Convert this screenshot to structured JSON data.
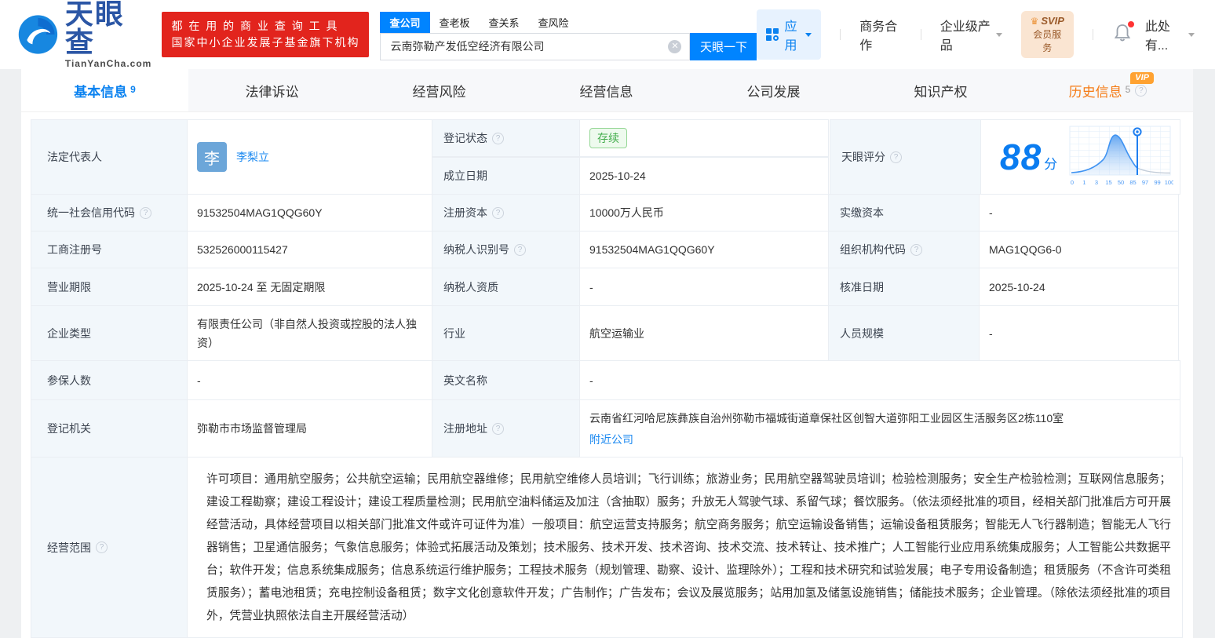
{
  "header": {
    "logo": {
      "title": "天眼查",
      "subtitle": "TianYanCha.com"
    },
    "slogan_line1": "都 在 用 的 商 业 查 询 工 具",
    "slogan_line2": "国家中小企业发展子基金旗下机构",
    "search": {
      "tabs": [
        {
          "label": "查公司",
          "active": true
        },
        {
          "label": "查老板",
          "active": false
        },
        {
          "label": "查关系",
          "active": false
        },
        {
          "label": "查风险",
          "active": false
        }
      ],
      "value": "云南弥勒产发低空经济有限公司",
      "button": "天眼一下"
    },
    "nav": {
      "apps": "应用",
      "business_coop": "商务合作",
      "enterprise_products": "企业级产品",
      "svip_line1": "SVIP",
      "svip_line2": "会员服务",
      "user_menu": "此处有..."
    }
  },
  "tabs": [
    {
      "label": "基本信息",
      "badge": "9"
    },
    {
      "label": "法律诉讼",
      "badge": ""
    },
    {
      "label": "经营风险",
      "badge": ""
    },
    {
      "label": "经营信息",
      "badge": ""
    },
    {
      "label": "公司发展",
      "badge": ""
    },
    {
      "label": "知识产权",
      "badge": ""
    },
    {
      "label": "历史信息",
      "badge": "5",
      "vip_tag": "VIP"
    }
  ],
  "fields": {
    "legal_rep": {
      "label": "法定代表人",
      "value": "李梨立",
      "avatar": "李"
    },
    "reg_status": {
      "label": "登记状态",
      "value": "存续"
    },
    "establish_date": {
      "label": "成立日期",
      "value": "2025-10-24"
    },
    "score": {
      "label": "天眼评分",
      "value": "88",
      "unit": "分"
    },
    "credit_code": {
      "label": "统一社会信用代码",
      "value": "91532504MAG1QQG60Y"
    },
    "reg_capital": {
      "label": "注册资本",
      "value": "10000万人民币"
    },
    "paid_capital": {
      "label": "实缴资本",
      "value": "-"
    },
    "reg_number": {
      "label": "工商注册号",
      "value": "532526000115427"
    },
    "taxpayer_id": {
      "label": "纳税人识别号",
      "value": "91532504MAG1QQG60Y"
    },
    "org_code": {
      "label": "组织机构代码",
      "value": "MAG1QQG6-0"
    },
    "business_term": {
      "label": "营业期限",
      "value": "2025-10-24 至 无固定期限"
    },
    "taxpayer_quality": {
      "label": "纳税人资质",
      "value": "-"
    },
    "approval_date": {
      "label": "核准日期",
      "value": "2025-10-24"
    },
    "company_type": {
      "label": "企业类型",
      "value": "有限责任公司（非自然人投资或控股的法人独资）"
    },
    "industry": {
      "label": "行业",
      "value": "航空运输业"
    },
    "staff_size": {
      "label": "人员规模",
      "value": "-"
    },
    "insured_count": {
      "label": "参保人数",
      "value": "-"
    },
    "english_name": {
      "label": "英文名称",
      "value": "-"
    },
    "reg_authority": {
      "label": "登记机关",
      "value": "弥勒市市场监督管理局"
    },
    "reg_address": {
      "label": "注册地址",
      "value": "云南省红河哈尼族彝族自治州弥勒市福城街道章保社区创智大道弥阳工业园区生活服务区2栋110室",
      "link": "附近公司"
    },
    "business_scope": {
      "label": "经营范围",
      "value": "许可项目：通用航空服务；公共航空运输；民用航空器维修；民用航空维修人员培训；飞行训练；旅游业务；民用航空器驾驶员培训；检验检测服务；安全生产检验检测；互联网信息服务；建设工程勘察；建设工程设计；建设工程质量检测；民用航空油料储运及加注（含抽取）服务；升放无人驾驶气球、系留气球；餐饮服务。（依法须经批准的项目，经相关部门批准后方可开展经营活动，具体经营项目以相关部门批准文件或许可证件为准）一般项目：航空运营支持服务；航空商务服务；航空运输设备销售；运输设备租赁服务；智能无人飞行器制造；智能无人飞行器销售；卫星通信服务；气象信息服务；体验式拓展活动及策划；技术服务、技术开发、技术咨询、技术交流、技术转让、技术推广；人工智能行业应用系统集成服务；人工智能公共数据平台；软件开发；信息系统集成服务；信息系统运行维护服务；工程技术服务（规划管理、勘察、设计、监理除外）；工程和技术研究和试验发展；电子专用设备制造；租赁服务（不含许可类租赁服务）；蓄电池租赁；充电控制设备租赁；数字文化创意软件开发；广告制作；广告发布；会议及展览服务；站用加氢及储氢设施销售；储能技术服务；企业管理。（除依法须经批准的项目外，凭营业执照依法自主开展经营活动）"
    }
  },
  "chart_data": {
    "type": "area",
    "title": "天眼评分分布曲线",
    "x_labels": [
      "0",
      "1",
      "3",
      "15",
      "50",
      "85",
      "97",
      "99",
      "100"
    ],
    "marker_value": 88,
    "accent_color": "#1f7ff0"
  },
  "colors": {
    "brand_blue": "#0084ff",
    "slogan_red": "#e2241d",
    "vip_orange": "#ffa231",
    "status_green": "#43ad4c"
  }
}
